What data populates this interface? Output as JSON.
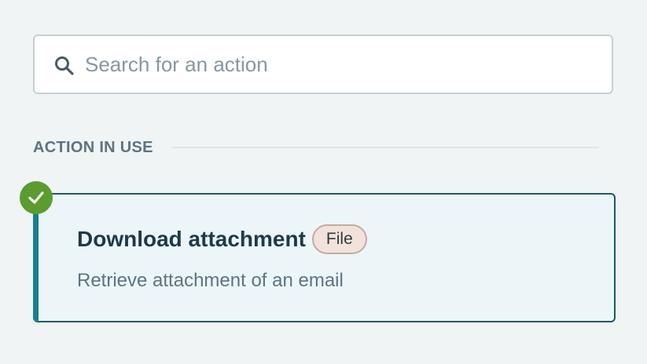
{
  "search": {
    "placeholder": "Search for an action",
    "value": "",
    "icon": "search-icon"
  },
  "section": {
    "title": "ACTION IN USE"
  },
  "action": {
    "title": "Download attachment",
    "badge": "File",
    "description": "Retrieve attachment of an email",
    "status_icon": "checkmark-icon",
    "selected": true
  },
  "colors": {
    "background": "#f0f4f5",
    "card_background": "#ecf6f9",
    "card_accent": "#16808e",
    "card_border": "#1d5a66",
    "check_green": "#5a9c2e",
    "badge_background": "#f2e2dc",
    "badge_border": "#c8a99f",
    "title_text": "#1e3a48",
    "muted_text": "#5f7380"
  }
}
